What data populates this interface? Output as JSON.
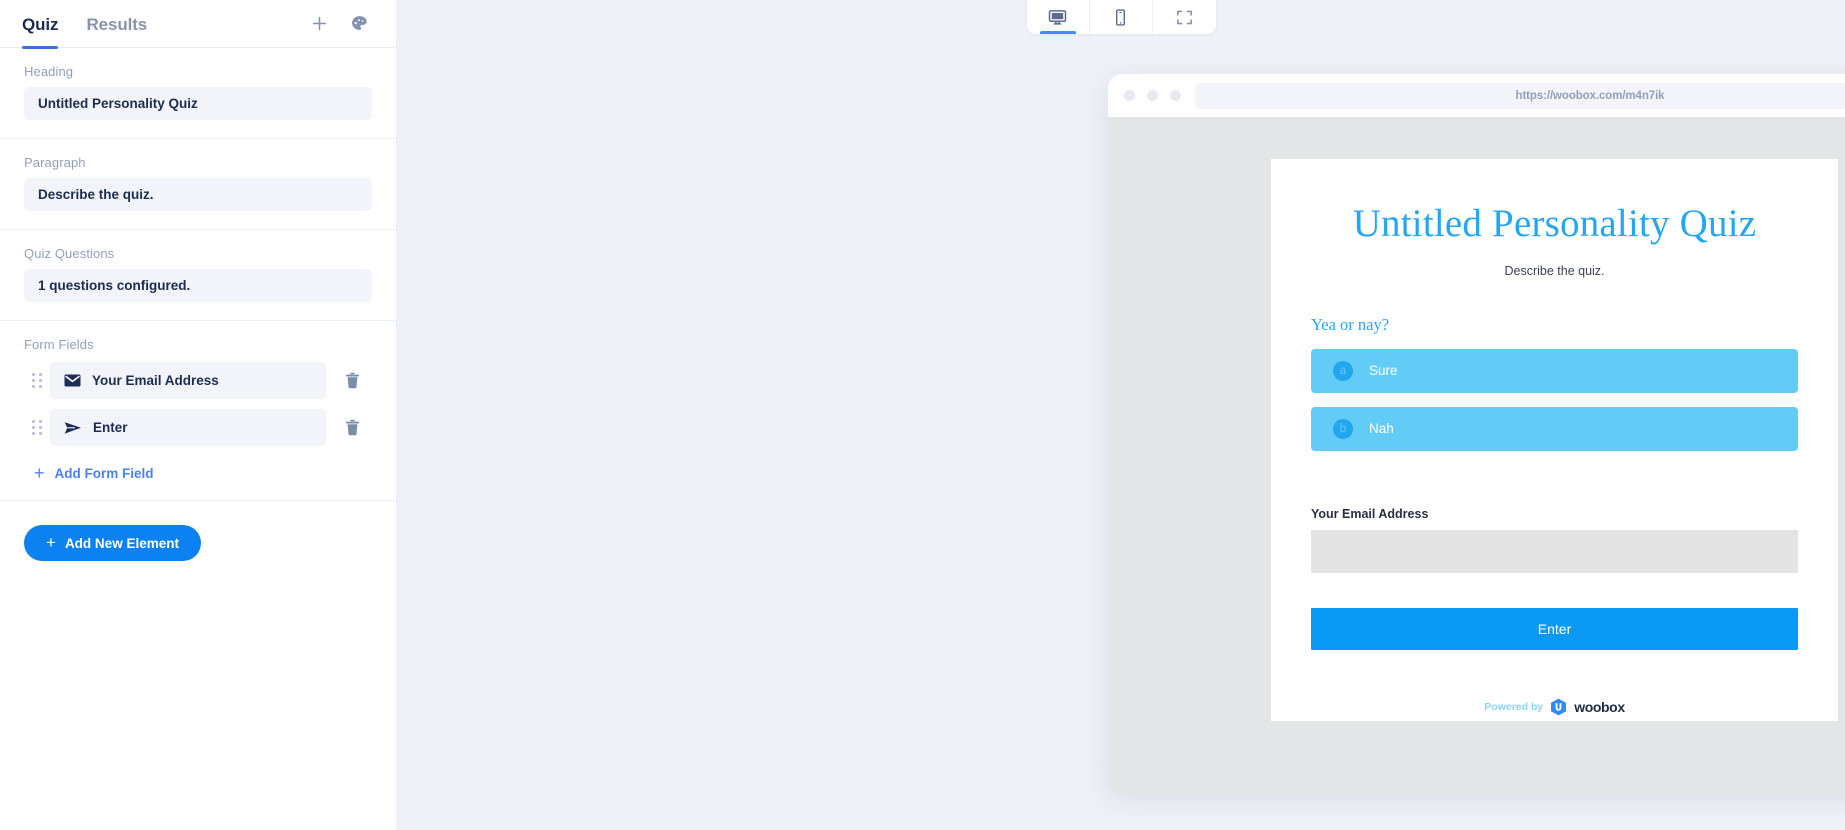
{
  "sidebar": {
    "tabs": [
      {
        "label": "Quiz",
        "active": true
      },
      {
        "label": "Results",
        "active": false
      }
    ],
    "actions": [
      {
        "name": "add-icon",
        "glyph": "+"
      },
      {
        "name": "palette-icon",
        "glyph": "palette"
      }
    ],
    "heading_section": {
      "label": "Heading",
      "value": "Untitled Personality Quiz"
    },
    "paragraph_section": {
      "label": "Paragraph",
      "value": "Describe the quiz."
    },
    "questions_section": {
      "label": "Quiz Questions",
      "value": "1 questions configured."
    },
    "form_fields_section": {
      "label": "Form Fields",
      "fields": [
        {
          "label": "Your Email Address",
          "icon": "envelope-icon"
        },
        {
          "label": "Enter",
          "icon": "paper-plane-icon"
        }
      ],
      "add_label": "Add Form Field"
    },
    "add_element_label": "Add New Element"
  },
  "preview": {
    "device_buttons": [
      {
        "name": "desktop-view",
        "icon": "monitor-icon",
        "active": true
      },
      {
        "name": "mobile-view",
        "icon": "phone-icon",
        "active": false
      },
      {
        "name": "fullscreen-view",
        "icon": "expand-icon",
        "active": false
      }
    ],
    "browser": {
      "url": "https://woobox.com/m4n7ik"
    },
    "quiz": {
      "title": "Untitled Personality Quiz",
      "subtitle": "Describe the quiz.",
      "question": "Yea or nay?",
      "answers": [
        {
          "key": "a",
          "text": "Sure"
        },
        {
          "key": "b",
          "text": "Nah"
        }
      ],
      "email_label": "Your Email Address",
      "email_value": "",
      "submit_label": "Enter",
      "powered_by_text": "Powered by",
      "powered_by_brand": "woobox"
    }
  },
  "colors": {
    "accent_blue": "#0b82f0",
    "tab_active": "#3d6fe0",
    "quiz_title_blue": "#23a7f2",
    "answer_bg": "#62ccf7",
    "sidebar_field_bg": "#f2f4f9"
  }
}
